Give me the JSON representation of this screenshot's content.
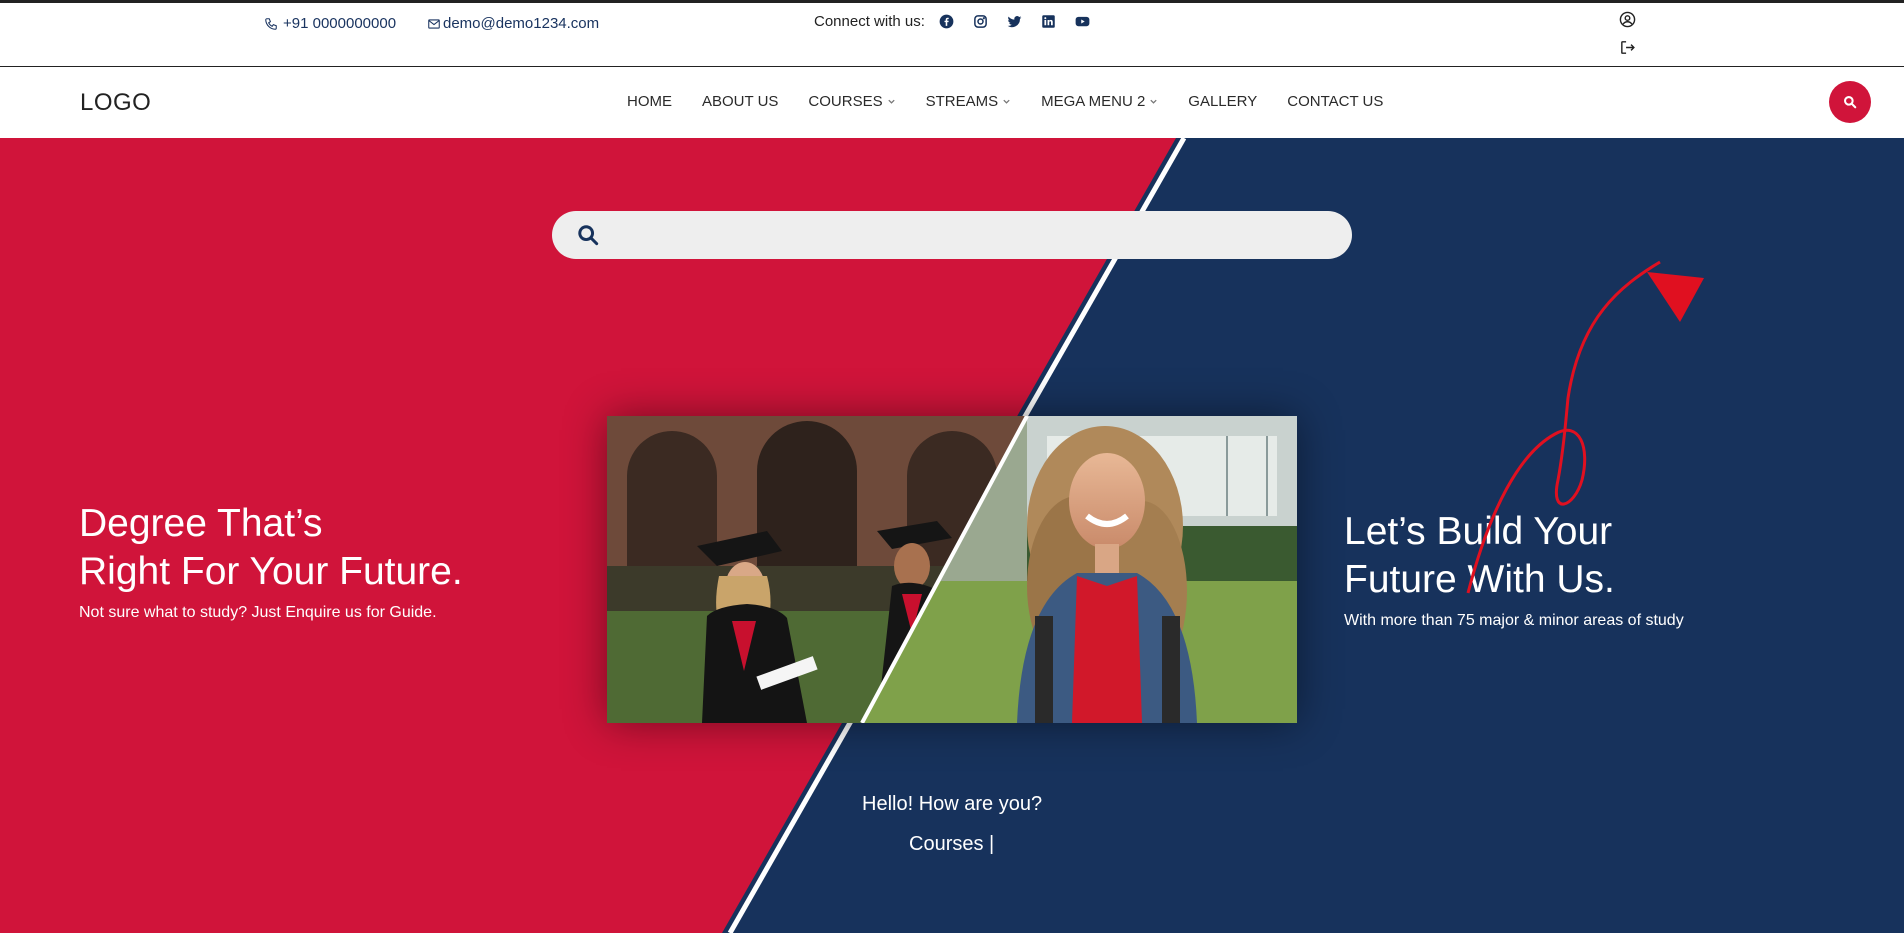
{
  "topbar": {
    "phone": "+91 0000000000",
    "email": "demo@demo1234.com",
    "connect_label": "Connect with us:",
    "social_icons": [
      "facebook-icon",
      "instagram-icon",
      "twitter-icon",
      "linkedin-icon",
      "youtube-icon"
    ],
    "user_icons": [
      "user-circle-icon",
      "logout-icon"
    ]
  },
  "nav": {
    "logo": "LOGO",
    "items": [
      "HOME",
      "ABOUT US",
      "COURSES",
      "STREAMS",
      "MEGA MENU 2",
      "GALLERY",
      "CONTACT US"
    ],
    "dropdown_items": [
      "COURSES",
      "STREAMS",
      "MEGA MENU 2"
    ],
    "search_icon": "search-icon"
  },
  "hero": {
    "search_placeholder": "",
    "left_heading_line1": "Degree That’s",
    "left_heading_line2": "Right For Your Future.",
    "left_sub": "Not sure what to study? Just Enquire us for Guide.",
    "right_heading_line1": "Let’s Build Your",
    "right_heading_line2": "Future With Us.",
    "right_sub": "With more than 75 major & minor areas of study",
    "greeting": "Hello! How are you?",
    "typing_text": "Courses |"
  },
  "colors": {
    "red": "#d0143a",
    "navy": "#17325c",
    "arrow": "#e01020"
  }
}
